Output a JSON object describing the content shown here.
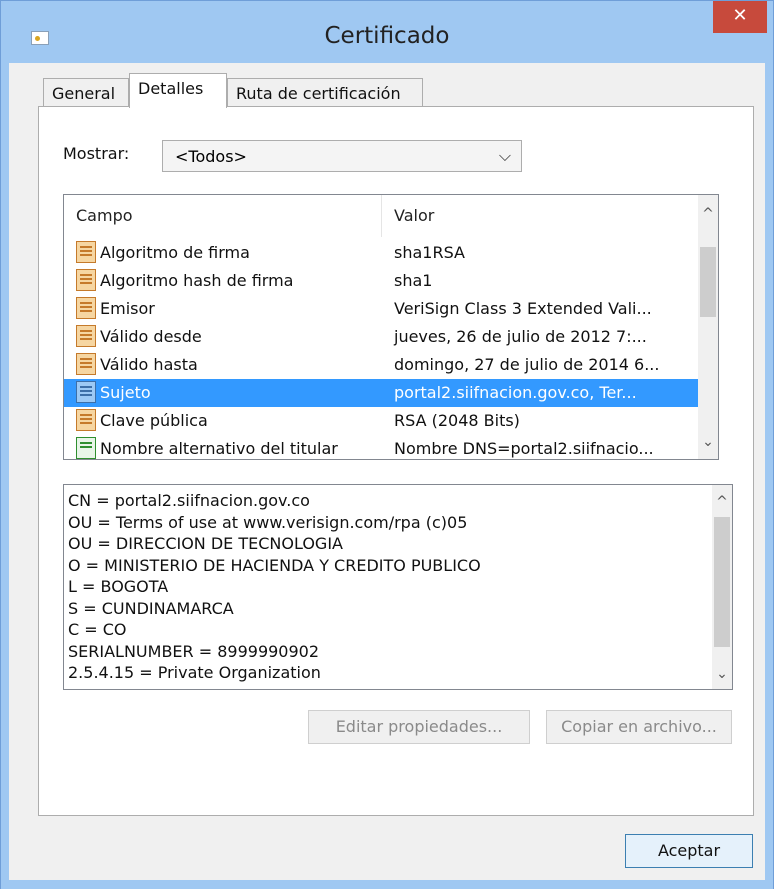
{
  "window": {
    "title": "Certificado",
    "close_label": "✕"
  },
  "tabs": [
    {
      "label": "General"
    },
    {
      "label": "Detalles"
    },
    {
      "label": "Ruta de certificación"
    }
  ],
  "show": {
    "label": "Mostrar:",
    "value": "<Todos>",
    "arrow": "⌵"
  },
  "list": {
    "columns": [
      "Campo",
      "Valor"
    ],
    "selected_index": 5,
    "rows": [
      {
        "field": "Algoritmo de firma",
        "value": "sha1RSA",
        "icon": "certificate-field-icon"
      },
      {
        "field": "Algoritmo hash de firma",
        "value": "sha1",
        "icon": "certificate-field-icon"
      },
      {
        "field": "Emisor",
        "value": "VeriSign Class 3 Extended Vali...",
        "icon": "certificate-field-icon"
      },
      {
        "field": "Válido desde",
        "value": "jueves, 26 de julio de 2012 7:...",
        "icon": "certificate-field-icon"
      },
      {
        "field": "Válido hasta",
        "value": "domingo, 27 de julio de 2014 6...",
        "icon": "certificate-field-icon"
      },
      {
        "field": "Sujeto",
        "value": "portal2.siifnacion.gov.co, Ter...",
        "icon": "certificate-field-icon"
      },
      {
        "field": "Clave pública",
        "value": "RSA (2048 Bits)",
        "icon": "certificate-field-icon"
      },
      {
        "field": "Nombre alternativo del titular",
        "value": "Nombre DNS=portal2.siifnacio...",
        "icon": "extension-field-icon"
      }
    ]
  },
  "detail_lines": [
    "CN = portal2.siifnacion.gov.co",
    "OU = Terms of use at www.verisign.com/rpa (c)05",
    "OU = DIRECCION DE TECNOLOGIA",
    "O = MINISTERIO DE HACIENDA Y CREDITO PUBLICO",
    "L = BOGOTA",
    "S = CUNDINAMARCA",
    "C = CO",
    "SERIALNUMBER = 8999990902",
    "2.5.4.15 = Private Organization"
  ],
  "buttons": {
    "edit": "Editar propiedades...",
    "copy": "Copiar en archivo...",
    "ok": "Aceptar"
  },
  "scroll": {
    "up": "^",
    "down": "⌄"
  },
  "colors": {
    "selection": "#3399ff",
    "titlebar": "#9fc8f2",
    "close": "#c74a3c"
  }
}
